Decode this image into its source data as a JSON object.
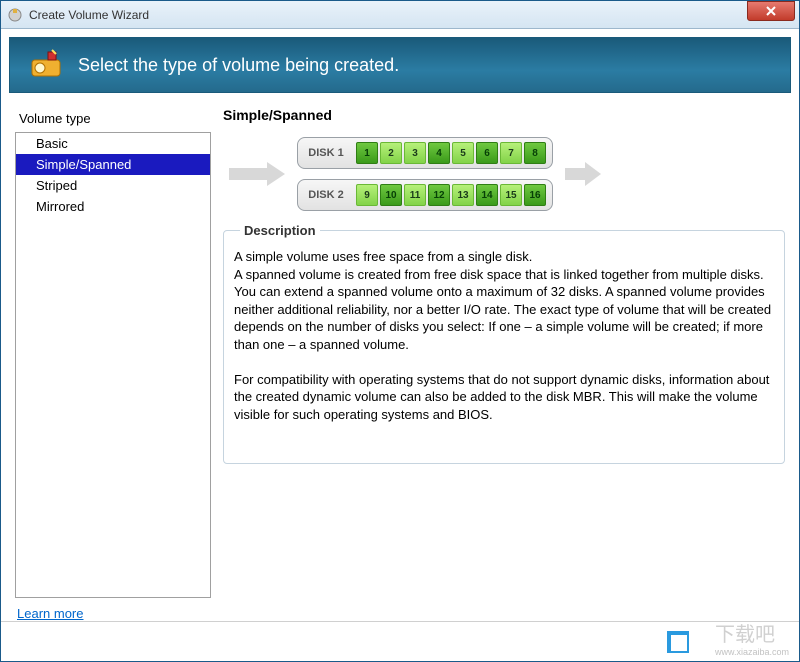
{
  "window": {
    "title": "Create Volume Wizard"
  },
  "header": {
    "text": "Select the type of volume being created."
  },
  "sidebar": {
    "title": "Volume type",
    "items": [
      {
        "label": "Basic",
        "selected": false
      },
      {
        "label": "Simple/Spanned",
        "selected": true
      },
      {
        "label": "Striped",
        "selected": false
      },
      {
        "label": "Mirrored",
        "selected": false
      }
    ]
  },
  "main": {
    "title": "Simple/Spanned",
    "disks": [
      {
        "label": "DISK 1",
        "blocks": [
          1,
          2,
          3,
          4,
          5,
          6,
          7,
          8
        ]
      },
      {
        "label": "DISK 2",
        "blocks": [
          9,
          10,
          11,
          12,
          13,
          14,
          15,
          16
        ]
      }
    ],
    "description_legend": "Description",
    "description": "A simple volume uses free space from a single disk.\nA spanned volume is created from free disk space that is linked together from multiple disks. You can extend a spanned volume onto a maximum of 32 disks. A spanned volume provides neither additional reliability, nor a better I/O rate. The exact type of volume that will be created depends on the number of disks you select: If one – a simple volume will be created; if more than one – a spanned volume.\n\nFor compatibility with operating systems that do not support dynamic disks, information about the created dynamic volume can also be added to the disk MBR. This will make the volume visible for such operating systems and BIOS."
  },
  "footer": {
    "learn_more": "Learn more"
  },
  "watermark": {
    "text": "下载吧",
    "url": "www.xiazaiba.com"
  }
}
